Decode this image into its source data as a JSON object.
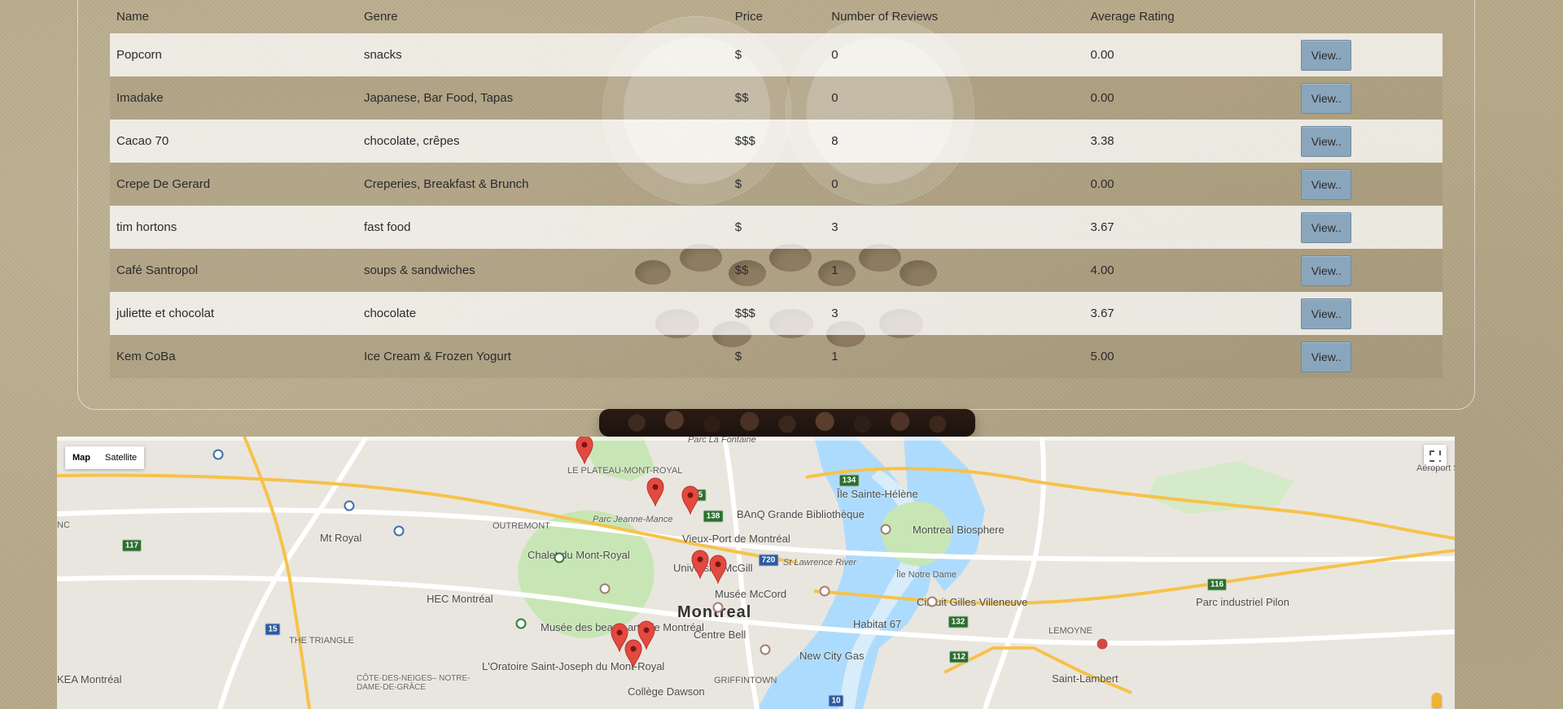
{
  "table": {
    "headers": [
      "Name",
      "Genre",
      "Price",
      "Number of Reviews",
      "Average Rating",
      ""
    ],
    "rows": [
      {
        "name": "Popcorn",
        "genre": "snacks",
        "price": "$",
        "reviews": "0",
        "rating": "0.00",
        "action": "View.."
      },
      {
        "name": "Imadake",
        "genre": "Japanese, Bar Food, Tapas",
        "price": "$$",
        "reviews": "0",
        "rating": "0.00",
        "action": "View.."
      },
      {
        "name": "Cacao 70",
        "genre": "chocolate, crêpes",
        "price": "$$$",
        "reviews": "8",
        "rating": "3.38",
        "action": "View.."
      },
      {
        "name": "Crepe De Gerard",
        "genre": "Creperies, Breakfast & Brunch",
        "price": "$",
        "reviews": "0",
        "rating": "0.00",
        "action": "View.."
      },
      {
        "name": "tim hortons",
        "genre": "fast food",
        "price": "$",
        "reviews": "3",
        "rating": "3.67",
        "action": "View.."
      },
      {
        "name": "Café Santropol",
        "genre": "soups & sandwiches",
        "price": "$$",
        "reviews": "1",
        "rating": "4.00",
        "action": "View.."
      },
      {
        "name": "juliette et chocolat",
        "genre": "chocolate",
        "price": "$$$",
        "reviews": "3",
        "rating": "3.67",
        "action": "View.."
      },
      {
        "name": "Kem CoBa",
        "genre": "Ice Cream & Frozen Yogurt",
        "price": "$",
        "reviews": "1",
        "rating": "5.00",
        "action": "View.."
      }
    ]
  },
  "map": {
    "type_buttons": [
      "Map",
      "Satellite"
    ],
    "active_type": "Map",
    "labels": {
      "city": "Montreal",
      "plateau": "LE PLATEAU-MONT-ROYAL",
      "parc_la_fontaine": "Parc La Fontaine",
      "parc_jeanne_mance": "Parc Jeanne-Mance",
      "outremont": "OUTREMONT",
      "mt_royal": "Mt Royal",
      "chalet": "Chalet du Mont-Royal",
      "hec": "HEC Montréal",
      "mcgill": "Université McGill",
      "banq": "BAnQ Grande Bibliothèque",
      "vieux_port": "Vieux-Port de Montréal",
      "mccord": "Musée McCord",
      "centre_bell": "Centre Bell",
      "beaux_arts": "Musée des beaux-arts de Montréal",
      "oratoire": "L'Oratoire Saint-Joseph du Mont-Royal",
      "college_dawson": "Collège Dawson",
      "new_city_gas": "New City Gas",
      "griffintown": "GRIFFINTOWN",
      "habitat": "Habitat 67",
      "st_lawrence": "St Lawrence River",
      "ile_ste_helene": "Île Sainte-Hélène",
      "biosphere": "Montreal Biosphere",
      "ile_notre_dame": "Île Notre Dame",
      "circuit": "Circuit Gilles Villeneuve",
      "parc_pilon": "Parc industriel Pilon",
      "lemoyne": "LEMOYNE",
      "saint_lambert": "Saint-Lambert",
      "the_triangle": "THE TRIANGLE",
      "cote_des_neiges": "CÔTE-DES-NEIGES– NOTRE-DAME-DE-GRÂCE",
      "ikea": "KEA Montréal",
      "nc": "NC",
      "airport": "Aéroport Saint-Hu"
    },
    "highways": [
      "335",
      "138",
      "134",
      "720",
      "116",
      "112",
      "132",
      "15",
      "117",
      "10"
    ]
  },
  "colors": {
    "view_button": "#8aa6bd",
    "marker_red": "#e34a3f",
    "water": "#aadaff",
    "park": "#c8e6b5"
  },
  "icons": {
    "map_marker": "map-marker-icon",
    "fullscreen": "fullscreen-icon",
    "pegman": "pegman-icon"
  }
}
